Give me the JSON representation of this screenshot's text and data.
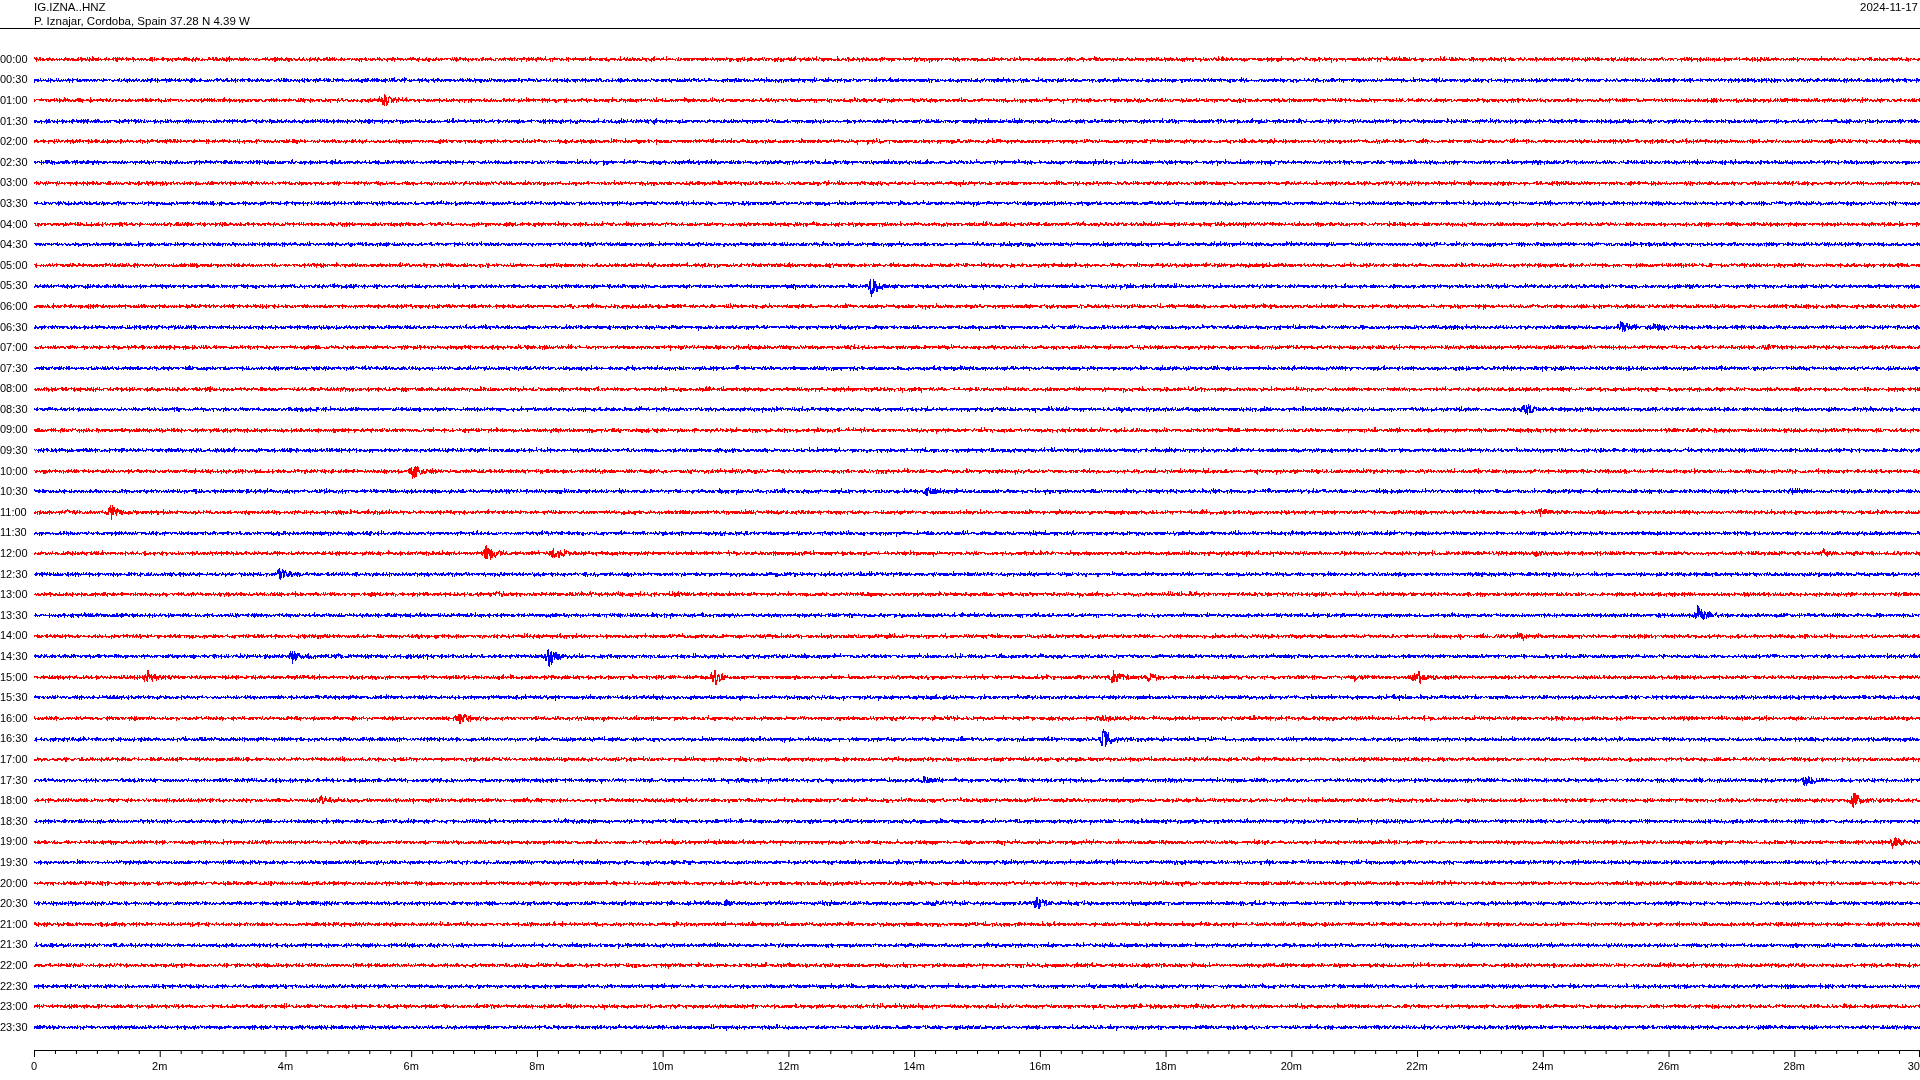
{
  "header": {
    "station": "IG.IZNA..HNZ",
    "location": "P. Iznajar, Cordoba, Spain  37.28 N 4.39 W",
    "date": "2024-11-17"
  },
  "traces": [
    {
      "label": "00:00",
      "color": "#ff0000"
    },
    {
      "label": "00:30",
      "color": "#0000ff"
    },
    {
      "label": "01:00",
      "color": "#ff0000"
    },
    {
      "label": "01:30",
      "color": "#0000ff"
    },
    {
      "label": "02:00",
      "color": "#ff0000"
    },
    {
      "label": "02:30",
      "color": "#0000ff"
    },
    {
      "label": "03:00",
      "color": "#ff0000"
    },
    {
      "label": "03:30",
      "color": "#0000ff"
    },
    {
      "label": "04:00",
      "color": "#ff0000"
    },
    {
      "label": "04:30",
      "color": "#0000ff"
    },
    {
      "label": "05:00",
      "color": "#ff0000"
    },
    {
      "label": "05:30",
      "color": "#0000ff"
    },
    {
      "label": "06:00",
      "color": "#ff0000"
    },
    {
      "label": "06:30",
      "color": "#0000ff"
    },
    {
      "label": "07:00",
      "color": "#ff0000"
    },
    {
      "label": "07:30",
      "color": "#0000ff"
    },
    {
      "label": "08:00",
      "color": "#ff0000"
    },
    {
      "label": "08:30",
      "color": "#0000ff"
    },
    {
      "label": "09:00",
      "color": "#ff0000"
    },
    {
      "label": "09:30",
      "color": "#0000ff"
    },
    {
      "label": "10:00",
      "color": "#ff0000"
    },
    {
      "label": "10:30",
      "color": "#0000ff"
    },
    {
      "label": "11:00",
      "color": "#ff0000"
    },
    {
      "label": "11:30",
      "color": "#0000ff"
    },
    {
      "label": "12:00",
      "color": "#ff0000"
    },
    {
      "label": "12:30",
      "color": "#0000ff"
    },
    {
      "label": "13:00",
      "color": "#ff0000"
    },
    {
      "label": "13:30",
      "color": "#0000ff"
    },
    {
      "label": "14:00",
      "color": "#ff0000"
    },
    {
      "label": "14:30",
      "color": "#0000ff"
    },
    {
      "label": "15:00",
      "color": "#ff0000"
    },
    {
      "label": "15:30",
      "color": "#0000ff"
    },
    {
      "label": "16:00",
      "color": "#ff0000"
    },
    {
      "label": "16:30",
      "color": "#0000ff"
    },
    {
      "label": "17:00",
      "color": "#ff0000"
    },
    {
      "label": "17:30",
      "color": "#0000ff"
    },
    {
      "label": "18:00",
      "color": "#ff0000"
    },
    {
      "label": "18:30",
      "color": "#0000ff"
    },
    {
      "label": "19:00",
      "color": "#ff0000"
    },
    {
      "label": "19:30",
      "color": "#0000ff"
    },
    {
      "label": "20:00",
      "color": "#ff0000"
    },
    {
      "label": "20:30",
      "color": "#0000ff"
    },
    {
      "label": "21:00",
      "color": "#ff0000"
    },
    {
      "label": "21:30",
      "color": "#0000ff"
    },
    {
      "label": "22:00",
      "color": "#ff0000"
    },
    {
      "label": "22:30",
      "color": "#0000ff"
    },
    {
      "label": "23:00",
      "color": "#ff0000"
    },
    {
      "label": "23:30",
      "color": "#0000ff"
    }
  ],
  "axis": {
    "labels": [
      "0",
      "2m",
      "4m",
      "6m",
      "8m",
      "10m",
      "12m",
      "14m",
      "16m",
      "18m",
      "20m",
      "22m",
      "24m",
      "26m",
      "28m",
      "30"
    ]
  }
}
